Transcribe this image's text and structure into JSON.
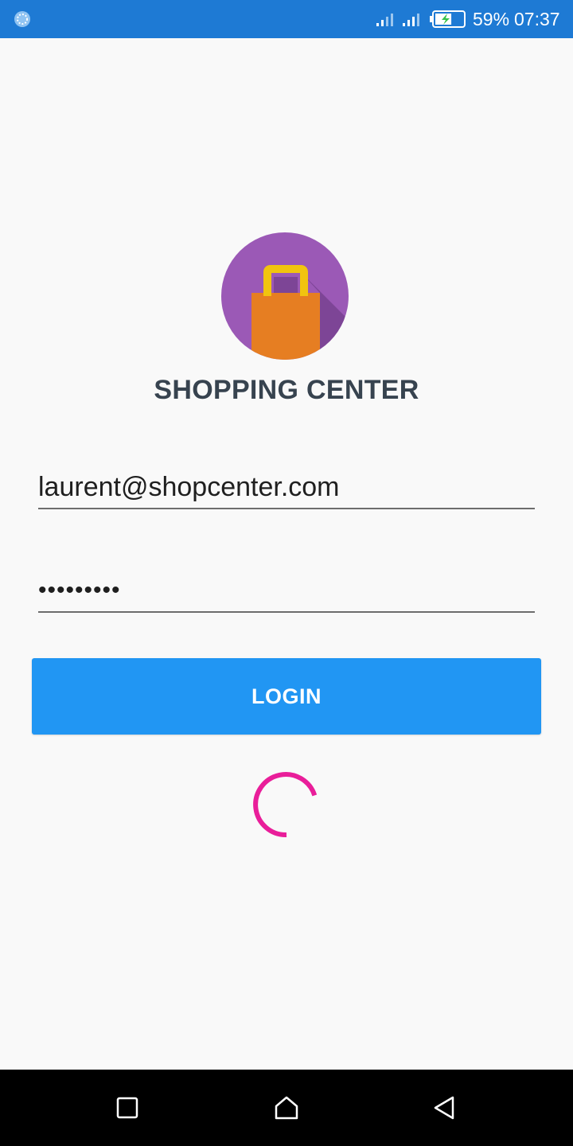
{
  "status_bar": {
    "battery_percent": "59%",
    "time": "07:37",
    "battery_level": 0.59,
    "background_color": "#1e7ad4"
  },
  "app": {
    "title": "SHOPPING CENTER",
    "logo_icon": "shopping-bag-icon",
    "logo_colors": {
      "circle": "#9b59b6",
      "bag": "#e67e22",
      "handle": "#f1c40f"
    }
  },
  "login_form": {
    "email_value": "laurent@shopcenter.com",
    "password_masked": "•••••••••",
    "login_label": "LOGIN",
    "button_color": "#2196f3",
    "spinner_color": "#e91e9a"
  },
  "nav_bar": {
    "recent_icon": "square-recents-icon",
    "home_icon": "home-icon",
    "back_icon": "back-triangle-icon"
  }
}
